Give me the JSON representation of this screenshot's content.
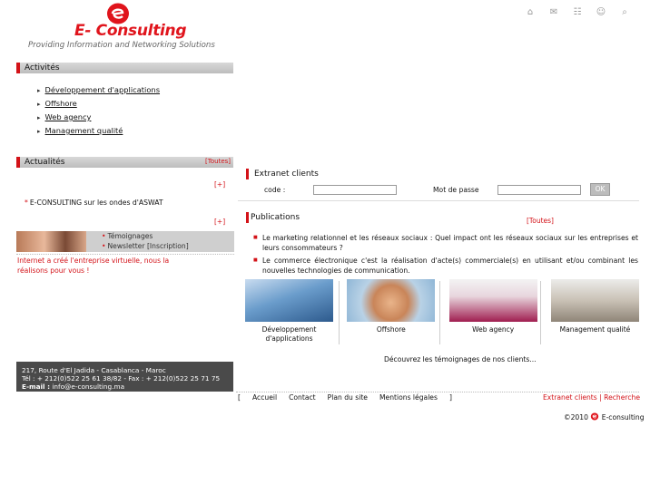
{
  "logo": {
    "name": "E- Consulting",
    "tagline": "Providing Information and Networking Solutions"
  },
  "top_icons": [
    "home-icon",
    "mail-icon",
    "sitemap-icon",
    "users-icon",
    "search-icon"
  ],
  "activites": {
    "title": "Activités",
    "items": [
      "Développement d'applications",
      "Offshore",
      "Web agency",
      "Management qualité"
    ]
  },
  "actualites": {
    "title": "Actualités",
    "all_link": "[Toutes]",
    "plus1": "[+]",
    "news": "E-CONSULTING sur les ondes d'ASWAT",
    "plus2": "[+]",
    "temoignages": "Témoignages",
    "newsletter": "Newsletter",
    "inscription": "[Inscription]",
    "promo": "Internet a créé l'entreprise virtuelle, nous la réalisons pour vous !"
  },
  "address": {
    "line1": "217, Route d'El Jadida - Casablanca - Maroc",
    "line2": "Tél : + 212(0)522 25 61 38/82 - Fax : + 212(0)522 25 71 75",
    "email_label": "E-mail :",
    "email": "info@e-consulting.ma"
  },
  "extranet": {
    "title": "Extranet clients",
    "code_label": "code :",
    "code_value": "",
    "password_label": "Mot de passe",
    "password_value": "",
    "ok": "OK"
  },
  "publications": {
    "title": "Publications",
    "all_link": "[Toutes]",
    "items": [
      "Le marketing relationnel et les réseaux sociaux : Quel impact ont les réseaux sociaux sur les entreprises et leurs consommateurs ?",
      "Le commerce électronique c'est la réalisation d'acte(s) commerciale(s) en utilisant et/ou combinant les nouvelles technologies de communication."
    ]
  },
  "tiles": [
    {
      "label": "Développement d'applications",
      "color": "#4d7db0"
    },
    {
      "label": "Offshore",
      "color": "#c9885a"
    },
    {
      "label": "Web agency",
      "color": "#b0265a"
    },
    {
      "label": "Management qualité",
      "color": "#b8b0a4"
    }
  ],
  "discover": "Découvrez les témoignages de nos clients...",
  "footer": {
    "open": "[",
    "links": [
      "Accueil",
      "Contact",
      "Plan du site",
      "Mentions légales"
    ],
    "close": "]",
    "extranet": "Extranet clients",
    "sep": "|",
    "recherche": "Recherche",
    "copyright": "©2010",
    "brand": "E-consulting"
  },
  "colors": {
    "accent": "#d31218",
    "header_gray": "#c8c8c8",
    "address_bg": "#4a4a4a"
  }
}
